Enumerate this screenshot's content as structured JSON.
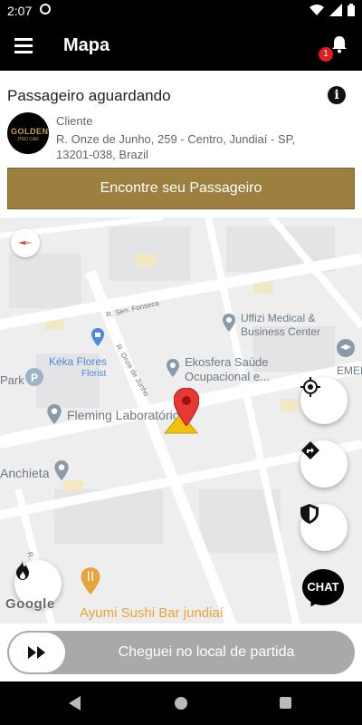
{
  "status_bar": {
    "time": "2:07"
  },
  "app_bar": {
    "title": "Mapa",
    "notification_count": "1"
  },
  "card": {
    "heading": "Passageiro aguardando",
    "avatar_logo": "GOLDEN",
    "avatar_logo_sub": "PRO CAR",
    "client_label": "Cliente",
    "client_address": "R. Onze de Junho, 259 - Centro, Jundiaí - SP, 13201-038, Brazil",
    "find_button": "Encontre seu Passageiro"
  },
  "map": {
    "streets": [
      "R. Sen. Fonseca",
      "R. Onze de Junho",
      "R."
    ],
    "pois": [
      "Uffizi Medical &",
      "Business Center",
      "Kéka Flores",
      "Florist",
      "Ekosfera Saúde",
      "Ocupacional e...",
      "EMEB",
      "Park",
      "Fleming Laboratório",
      "Anchieta",
      "Ayumi Sushi Bar jundiaí"
    ],
    "google_logo": "Google",
    "chat_label": "CHAT"
  },
  "bottom": {
    "slider_text": "Cheguei no local de partida"
  },
  "colors": {
    "gold": "#9d7f3f",
    "badge": "#e31b23",
    "pin": "#e53935",
    "poi_blue": "#4a8ad6",
    "poi_gray": "#6b7b86",
    "poi_food": "#e8a33a"
  }
}
